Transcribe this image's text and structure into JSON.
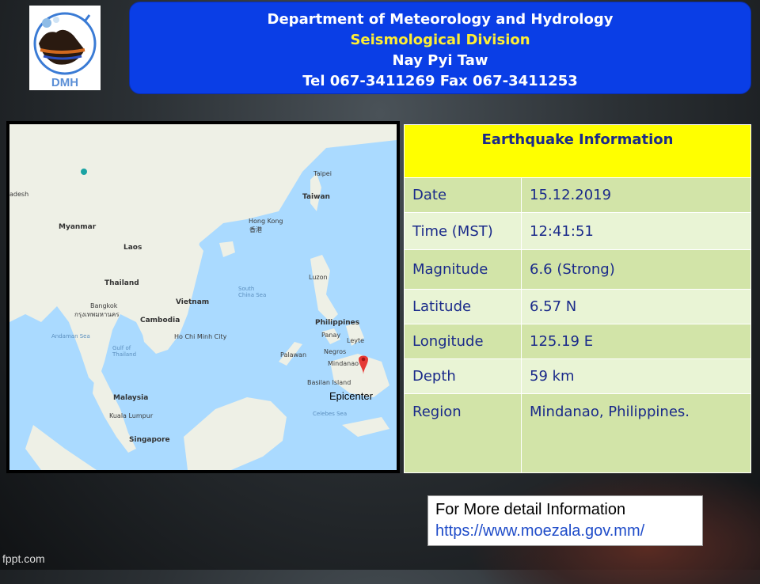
{
  "header": {
    "line1": "Department of Meteorology and Hydrology",
    "line2": "Seismological  Division",
    "line3": "Nay Pyi Taw",
    "line4": "Tel 067-3411269  Fax 067-3411253"
  },
  "logo": {
    "text": "DMH"
  },
  "map": {
    "labels": {
      "myanmar": "Myanmar",
      "laos": "Laos",
      "thailand": "Thailand",
      "vietnam": "Vietnam",
      "cambodia": "Cambodia",
      "bangkok": "Bangkok",
      "bangkok_local": "กรุงเทพมหานคร",
      "hochiminh": "Ho Chi\nMinh City",
      "malaysia": "Malaysia",
      "kualalumpur": "Kuala Lumpur",
      "singapore": "Singapore",
      "philippines": "Philippines",
      "luzon": "Luzon",
      "taipei": "Taipei",
      "taiwan": "Taiwan",
      "hongkong": "Hong Kong",
      "hongkong_local": "香港",
      "south_china_sea": "South\nChina Sea",
      "andaman_sea": "Andaman Sea",
      "gulf_thailand": "Gulf of\nThailand",
      "celebes_sea": "Celebes Sea",
      "palawan": "Palawan",
      "panay": "Panay",
      "negros": "Negros",
      "leyte": "Leyte",
      "mindanao": "Mindanao",
      "basilan": "Basilan Island",
      "bangladesh": "adesh"
    },
    "epicenter_label": "Epicenter"
  },
  "info": {
    "title": "Earthquake Information",
    "rows": [
      {
        "label": "Date",
        "value": "15.12.2019"
      },
      {
        "label": "Time (MST)",
        "value": "12:41:51"
      },
      {
        "label": "Magnitude",
        "value": "6.6 (Strong)"
      },
      {
        "label": "Latitude",
        "value": "6.57 N"
      },
      {
        "label": "Longitude",
        "value": "125.19 E"
      },
      {
        "label": "Depth",
        "value": "59 km"
      },
      {
        "label": "Region",
        "value": "Mindanao, Philippines."
      }
    ]
  },
  "more": {
    "line1": "For More detail Information",
    "link": "https://www.moezala.gov.mm/"
  },
  "footer": {
    "brand": "fppt.com"
  },
  "colors": {
    "header_bg": "#0a3ee6",
    "header_accent": "#ffee33",
    "table_head": "#ffff00",
    "row_dark": "#d2e4a8",
    "row_light": "#e9f4d5",
    "text_blue": "#1a2a8a"
  }
}
